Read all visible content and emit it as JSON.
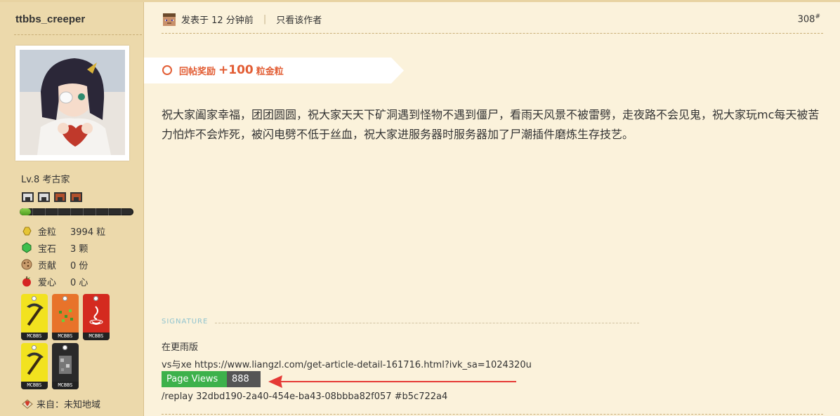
{
  "user": {
    "name": "ttbbs_creeper",
    "level": "Lv.8 考古家",
    "xp_fraction": 0.1,
    "stats": [
      {
        "label": "金粒",
        "value": "3994 粒",
        "icon": "gold-nugget-icon"
      },
      {
        "label": "宝石",
        "value": "3 颗",
        "icon": "emerald-icon"
      },
      {
        "label": "贡献",
        "value": "0 份",
        "icon": "cookie-icon"
      },
      {
        "label": "爱心",
        "value": "0 心",
        "icon": "apple-icon"
      }
    ],
    "badge_text": "MCBBS",
    "from": "来自：未知地域"
  },
  "post": {
    "posted_at": "发表于 12 分钟前",
    "author_only": "只看该作者",
    "floor": "308",
    "floor_mark": "#",
    "reward_prefix": "回帖奖励",
    "reward_amount": "+100",
    "reward_suffix": "粒金粒",
    "content": "祝大家阖家幸福，团团圆圆，祝大家天天下矿洞遇到怪物不遇到僵尸，看雨天风景不被雷劈，走夜路不会见鬼，祝大家玩mc每天被苦力怕炸不会炸死，被闪电劈不低于丝血，祝大家进服务器时服务器加了尸潮插件磨炼生存技艺。"
  },
  "signature": {
    "label": "SIGNATURE",
    "line1": "在更雨版",
    "line2": "vs与xe https://www.liangzl.com/get-article-detail-161716.html?ivk_sa=1024320u",
    "page_views_label": "Page Views",
    "page_views_value": "888",
    "line4": "/replay 32dbd190-2a40-454e-ba43-08bbba82f057 #b5c722a4"
  },
  "colors": {
    "page_bg": "#fbf2db",
    "sidebar_bg": "#ecd9ab",
    "reward_orange": "#e25d34",
    "page_views_green": "#3db14b",
    "arrow_red": "#e53935"
  }
}
